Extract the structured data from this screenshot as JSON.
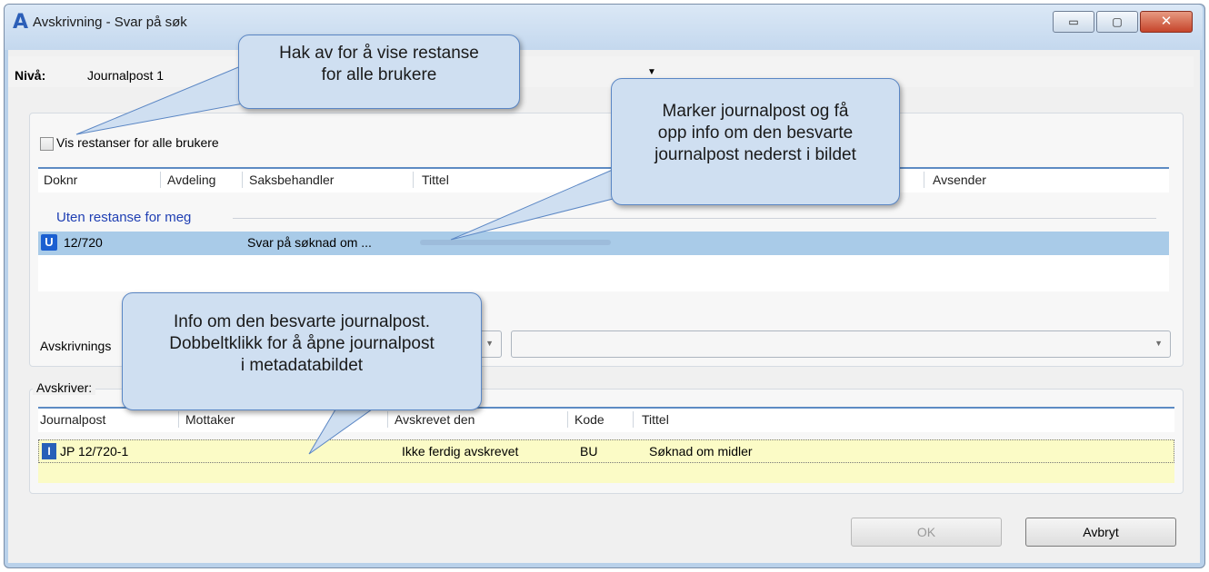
{
  "window": {
    "title": "Avskrivning - Svar på søk",
    "app_icon": "A",
    "buttons": {
      "minimize": "▭",
      "maximize": "▢",
      "close": "✕"
    }
  },
  "level": {
    "label": "Nivå:",
    "value": "Journalpost 1"
  },
  "checkbox": {
    "label": "Vis restanser for alle brukere",
    "checked": false
  },
  "table1": {
    "columns": [
      "Doknr",
      "Avdeling",
      "Saksbehandler",
      "Tittel",
      "Avsender"
    ],
    "group_header": "Uten restanse for meg",
    "rows": [
      {
        "badge": "U",
        "doknr": "12/720",
        "avdeling": "",
        "saksbehandler": "Svar på  søknad om ...",
        "tittel": "",
        "avsender": ""
      }
    ]
  },
  "avskrivning_label": "Avskrivnings",
  "group2": {
    "legend": "Avskriver:",
    "columns": [
      "Journalpost",
      "Mottaker",
      "Avskrevet den",
      "Kode",
      "Tittel"
    ],
    "rows": [
      {
        "journalpost": "JP 12/720-1",
        "mottaker": "",
        "avskrevet_den": "Ikke ferdig avskrevet",
        "kode": "BU",
        "tittel": "Søknad om midler"
      }
    ]
  },
  "buttons": {
    "ok": "OK",
    "cancel": "Avbryt"
  },
  "callouts": {
    "c1": [
      "Hak av for å vise restanse",
      "for alle brukere"
    ],
    "c2": [
      "Marker journalpost og få",
      "opp info om den besvarte",
      "journalpost nederst i bildet"
    ],
    "c3": [
      "Info om den besvarte journalpost.",
      "Dobbeltklikk for å åpne journalpost",
      "i metadatabildet"
    ]
  }
}
